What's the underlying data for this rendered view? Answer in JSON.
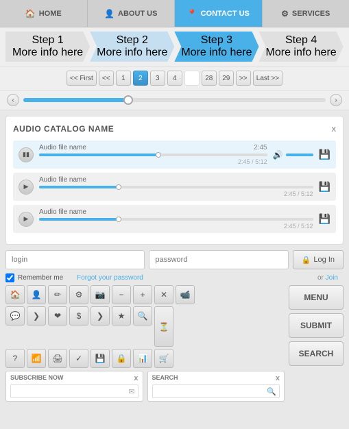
{
  "nav": {
    "items": [
      {
        "id": "home",
        "label": "HOME",
        "icon": "🏠",
        "active": false
      },
      {
        "id": "about",
        "label": "ABOUT US",
        "icon": "👤",
        "active": false
      },
      {
        "id": "contact",
        "label": "CONTACT US",
        "icon": "📍",
        "active": true
      },
      {
        "id": "services",
        "label": "SERVICES",
        "icon": "⚙",
        "active": false
      }
    ]
  },
  "steps": [
    {
      "id": "step1",
      "label": "Step 1",
      "sub": "More info here",
      "active": false,
      "completed": false
    },
    {
      "id": "step2",
      "label": "Step 2",
      "sub": "More info here",
      "active": false,
      "completed": false
    },
    {
      "id": "step3",
      "label": "Step 3",
      "sub": "More info here",
      "active": true,
      "completed": false
    },
    {
      "id": "step4",
      "label": "Step 4",
      "sub": "More info here",
      "active": false,
      "completed": false
    }
  ],
  "pagination": {
    "first": "<< First",
    "prev_prev": "<<",
    "last": "Last >>",
    "next_next": ">>",
    "pages": [
      "1",
      "2",
      "3",
      "4",
      "",
      "28",
      "29"
    ],
    "active_page": "2"
  },
  "audio_catalog": {
    "title": "AUDIO CATALOG NAME",
    "close": "x",
    "tracks": [
      {
        "name": "Audio file name",
        "time": "2:45",
        "total": "5:12",
        "progress": 53,
        "thumb_pos": "51%",
        "active": true
      },
      {
        "name": "Audio file name",
        "time": "2:45",
        "total": "5:12",
        "progress": 30,
        "thumb_pos": "28%",
        "active": false
      },
      {
        "name": "Audio file name",
        "time": "2:45",
        "total": "5:12",
        "progress": 30,
        "thumb_pos": "28%",
        "active": false
      }
    ]
  },
  "login": {
    "login_placeholder": "login",
    "password_placeholder": "password",
    "login_btn": "Log In",
    "lock_icon": "🔒",
    "remember_label": "Remember me",
    "forgot_label": "Forgot your password",
    "or_join": "or Join"
  },
  "icon_grid": {
    "icons": [
      "🏠",
      "👤",
      "✏",
      "⚙",
      "📷",
      "−",
      "+",
      "✕",
      "📹",
      "💬",
      "❯",
      "❤",
      "$",
      "❯",
      "★",
      "🔍",
      "?",
      "📶",
      "🖨",
      "✓",
      "💾",
      "🔒",
      "📊",
      "🛒",
      "⏳"
    ]
  },
  "buttons": {
    "menu": "MENU",
    "submit": "SUBMIT",
    "search": "SEARCH"
  },
  "subscribe": {
    "label": "SUBSCRIBE NOW",
    "close": "x",
    "placeholder": ""
  },
  "search_bar": {
    "label": "SEARCH",
    "close": "x",
    "placeholder": ""
  }
}
